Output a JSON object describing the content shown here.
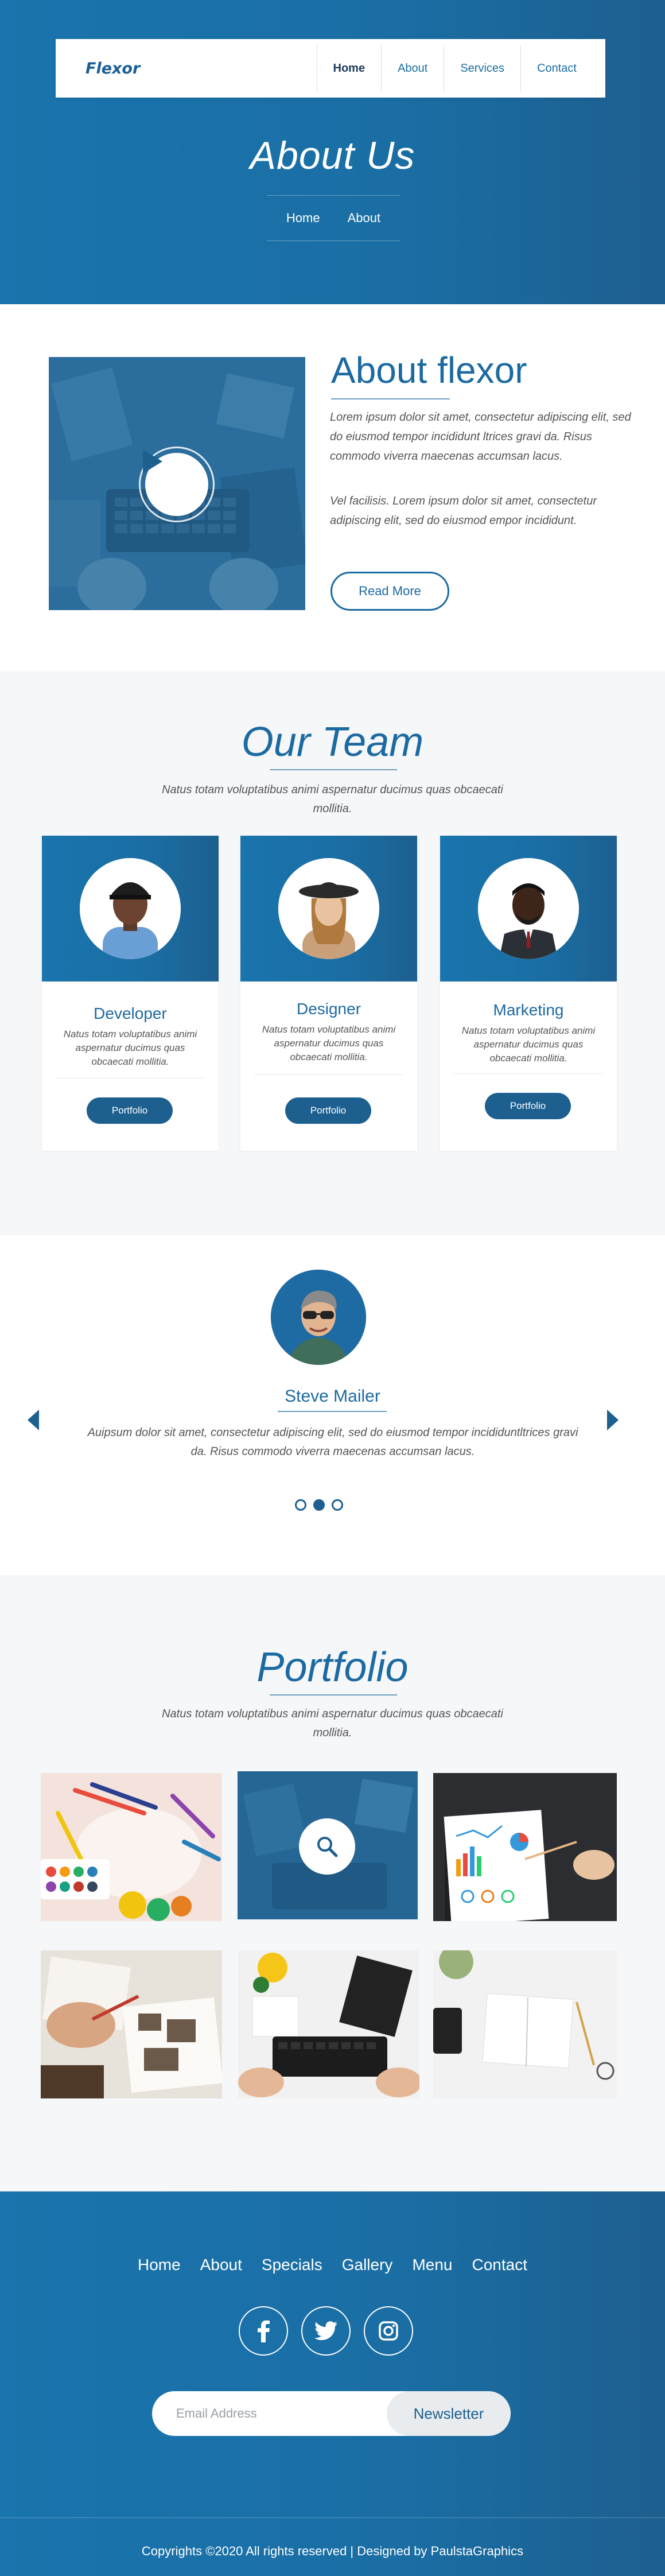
{
  "header": {
    "brand": "Flexor",
    "nav": [
      "Home",
      "About",
      "Services",
      "Contact"
    ],
    "active": "Home"
  },
  "hero": {
    "title": "About Us",
    "breadcrumb": [
      "Home",
      "About"
    ]
  },
  "about": {
    "title": "About flexor",
    "paragraphs": [
      "Lorem ipsum dolor sit amet, consectetur adipiscing elit, sed do eiusmod tempor incididunt ltrices gravi da. Risus commodo viverra maecenas accumsan lacus.",
      "Vel facilisis. Lorem ipsum dolor sit amet, consectetur adipiscing elit, sed do eiusmod empor incididunt."
    ],
    "button": "Read More",
    "video_icon": "play-icon"
  },
  "team": {
    "title": "Our Team",
    "subtitle": "Natus totam voluptatibus animi aspernatur ducimus quas obcaecati mollitia.",
    "members": [
      {
        "role": "Developer",
        "desc": "Natus totam voluptatibus animi aspernatur ducimus quas obcaecati mollitia.",
        "button": "Portfolio"
      },
      {
        "role": "Designer",
        "desc": "Natus totam voluptatibus animi aspernatur ducimus quas obcaecati mollitia.",
        "button": "Portfolio"
      },
      {
        "role": "Marketing",
        "desc": "Natus totam voluptatibus animi aspernatur ducimus quas obcaecati mollitia.",
        "button": "Portfolio"
      }
    ]
  },
  "testimonial": {
    "name": "Steve Mailer",
    "quote": "Auipsum dolor sit amet, consectetur adipiscing elit, sed do eiusmod tempor incididuntltrices gravi da. Risus commodo viverra maecenas accumsan lacus.",
    "slides": 3,
    "active_slide": 2
  },
  "portfolio": {
    "title": "Portfolio",
    "subtitle": "Natus totam voluptatibus animi aspernatur ducimus quas obcaecati mollitia.",
    "zoom_icon": "search-icon"
  },
  "footer": {
    "nav": [
      "Home",
      "About",
      "Specials",
      "Gallery",
      "Menu",
      "Contact"
    ],
    "social": [
      "facebook-icon",
      "twitter-icon",
      "instagram-icon"
    ],
    "newsletter": {
      "placeholder": "Email Address",
      "button": "Newsletter"
    },
    "copyright": "Copyrights ©2020 All rights reserved | Designed by PaulstaGraphics"
  },
  "colors": {
    "primary": "#1a74ad",
    "primary_dark": "#1d5f8f",
    "heading": "#1c6aa2",
    "light_bg": "#f6f7f9"
  }
}
